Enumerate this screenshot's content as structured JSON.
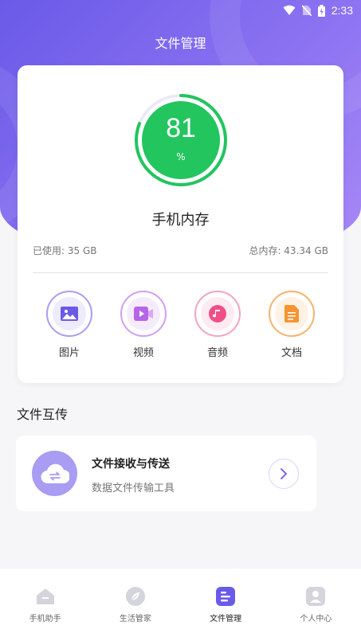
{
  "status_bar": {
    "time": "2:33"
  },
  "header": {
    "title": "文件管理"
  },
  "storage": {
    "percent": "81",
    "percent_fraction": 0.81,
    "unit": "%",
    "title": "手机内存",
    "used_label": "已使用: 35 GB",
    "total_label": "总内存: 43.34 GB",
    "gauge_color": "#22c55e"
  },
  "categories": [
    {
      "label": "图片",
      "icon": "image-icon",
      "color": "#7b6cf0"
    },
    {
      "label": "视频",
      "icon": "video-icon",
      "color": "#b565e6"
    },
    {
      "label": "音频",
      "icon": "music-icon",
      "color": "#ef4f86"
    },
    {
      "label": "文档",
      "icon": "document-icon",
      "color": "#f59432"
    }
  ],
  "transfer_section": {
    "title": "文件互传",
    "card_title": "文件接收与传送",
    "card_subtitle": "数据文件传输工具"
  },
  "bottom_nav": [
    {
      "label": "手机助手",
      "icon": "home-icon",
      "active": false
    },
    {
      "label": "生活管家",
      "icon": "leaf-icon",
      "active": false
    },
    {
      "label": "文件管理",
      "icon": "file-list-icon",
      "active": true
    },
    {
      "label": "个人中心",
      "icon": "profile-icon",
      "active": false
    }
  ],
  "colors": {
    "accent": "#6a5ae8",
    "card": "#ffffff",
    "background": "#f6f6f8"
  }
}
